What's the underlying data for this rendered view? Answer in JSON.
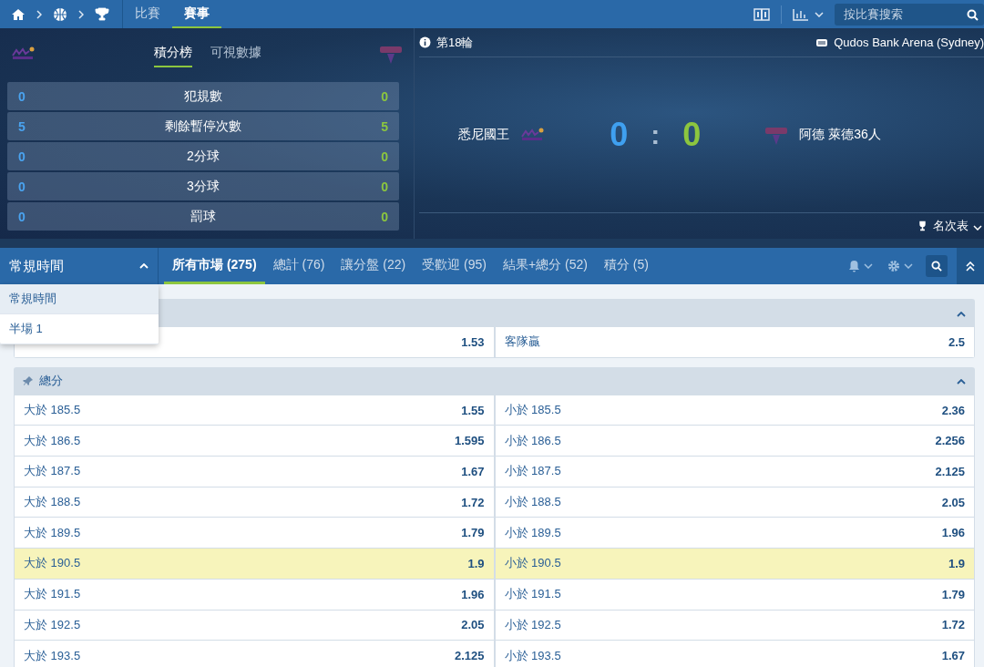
{
  "nav_tabs": [
    {
      "label": "比賽",
      "selected": false
    },
    {
      "label": "賽事",
      "selected": true
    }
  ],
  "search": {
    "placeholder": "按比賽搜索"
  },
  "stats_tabs": [
    {
      "label": "積分榜",
      "selected": true
    },
    {
      "label": "可視數據",
      "selected": false
    }
  ],
  "stats": [
    {
      "home": "0",
      "label": "犯規數",
      "away": "0"
    },
    {
      "home": "5",
      "label": "剩餘暫停次數",
      "away": "5"
    },
    {
      "home": "0",
      "label": "2分球",
      "away": "0"
    },
    {
      "home": "0",
      "label": "3分球",
      "away": "0"
    },
    {
      "home": "0",
      "label": "罰球",
      "away": "0"
    }
  ],
  "match": {
    "round": "第18輪",
    "venue": "Qudos Bank Arena (Sydney)",
    "home_team": "悉尼國王",
    "home_score": "0",
    "separator": ":",
    "away_score": "0",
    "away_team": "阿德 萊德36人",
    "standings": "名次表"
  },
  "period_select": {
    "value": "常規時間",
    "expanded": true,
    "options": [
      {
        "label": "常規時間",
        "selected": true
      },
      {
        "label": "半場 1",
        "selected": false
      }
    ]
  },
  "market_tabs": [
    {
      "label": "所有市場 (275)",
      "selected": true
    },
    {
      "label": "總計 (76)",
      "selected": false
    },
    {
      "label": "讓分盤 (22)",
      "selected": false
    },
    {
      "label": "受歡迎 (95)",
      "selected": false
    },
    {
      "label": "結果+總分 (52)",
      "selected": false
    },
    {
      "label": "積分 (5)",
      "selected": false
    }
  ],
  "markets": [
    {
      "expanded": true,
      "rows": [
        {
          "left_odds": "1.53",
          "right_label": "客隊贏",
          "right_odds": "2.5",
          "highlighted": false
        }
      ]
    },
    {
      "title": "總分",
      "pinned": true,
      "expanded": true,
      "rows": [
        {
          "left_label": "大於 185.5",
          "left_odds": "1.55",
          "right_label": "小於 185.5",
          "right_odds": "2.36",
          "highlighted": false
        },
        {
          "left_label": "大於 186.5",
          "left_odds": "1.595",
          "right_label": "小於 186.5",
          "right_odds": "2.256",
          "highlighted": false
        },
        {
          "left_label": "大於 187.5",
          "left_odds": "1.67",
          "right_label": "小於 187.5",
          "right_odds": "2.125",
          "highlighted": false
        },
        {
          "left_label": "大於 188.5",
          "left_odds": "1.72",
          "right_label": "小於 188.5",
          "right_odds": "2.05",
          "highlighted": false
        },
        {
          "left_label": "大於 189.5",
          "left_odds": "1.79",
          "right_label": "小於 189.5",
          "right_odds": "1.96",
          "highlighted": false
        },
        {
          "left_label": "大於 190.5",
          "left_odds": "1.9",
          "right_label": "小於 190.5",
          "right_odds": "1.9",
          "highlighted": true
        },
        {
          "left_label": "大於 191.5",
          "left_odds": "1.96",
          "right_label": "小於 191.5",
          "right_odds": "1.79",
          "highlighted": false
        },
        {
          "left_label": "大於 192.5",
          "left_odds": "2.05",
          "right_label": "小於 192.5",
          "right_odds": "1.72",
          "highlighted": false
        },
        {
          "left_label": "大於 193.5",
          "left_odds": "2.125",
          "right_label": "小於 193.5",
          "right_odds": "1.67",
          "highlighted": false
        }
      ]
    }
  ]
}
